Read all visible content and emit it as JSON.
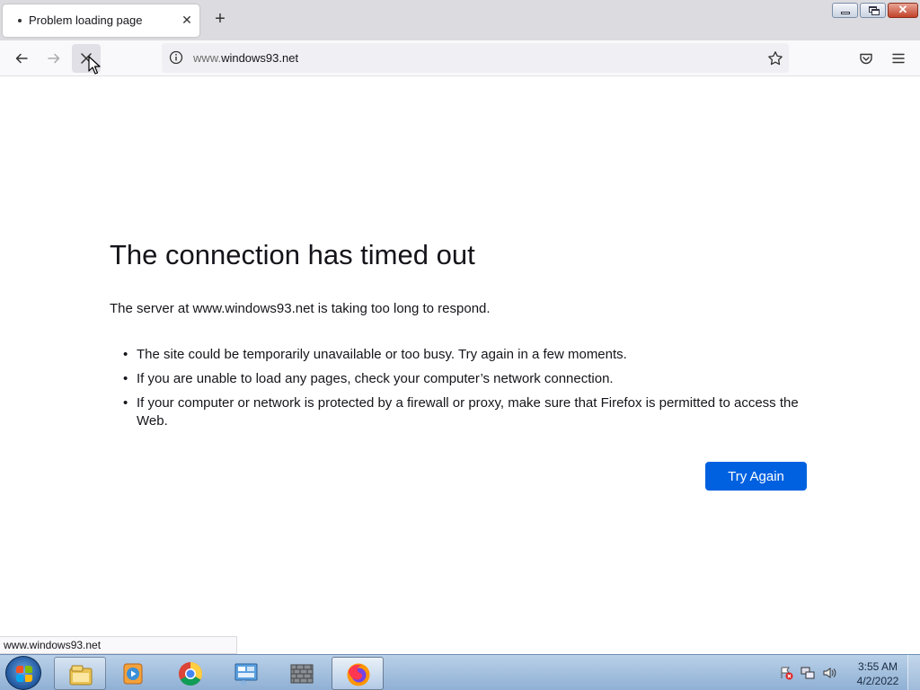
{
  "window": {
    "tab_title": "Problem loading page",
    "new_tab_icon": "plus-icon",
    "tab_close_icon": "close-icon"
  },
  "navbar": {
    "url_prefix": "www.",
    "url_domain": "windows93.net",
    "icons": [
      "back-arrow-icon",
      "forward-arrow-icon",
      "stop-icon",
      "info-icon",
      "star-icon",
      "pocket-icon",
      "hamburger-menu-icon"
    ]
  },
  "error": {
    "title": "The connection has timed out",
    "description": "The server at www.windows93.net is taking too long to respond.",
    "bullets": [
      "The site could be temporarily unavailable or too busy. Try again in a few moments.",
      "If you are unable to load any pages, check your computer’s network connection.",
      "If your computer or network is protected by a firewall or proxy, make sure that Firefox is permitted to access the Web."
    ],
    "button_label": "Try Again",
    "button_color": "#0061e0"
  },
  "status_bar": {
    "text": "www.windows93.net"
  },
  "taskbar": {
    "items": [
      "file-explorer-icon",
      "media-player-icon",
      "chrome-icon",
      "control-panel-icon",
      "firewall-icon",
      "firefox-icon"
    ],
    "clock_time": "3:55 AM",
    "clock_date": "4/2/2022",
    "tray_icons": [
      "action-center-alert-icon",
      "network-icon",
      "volume-icon"
    ]
  }
}
